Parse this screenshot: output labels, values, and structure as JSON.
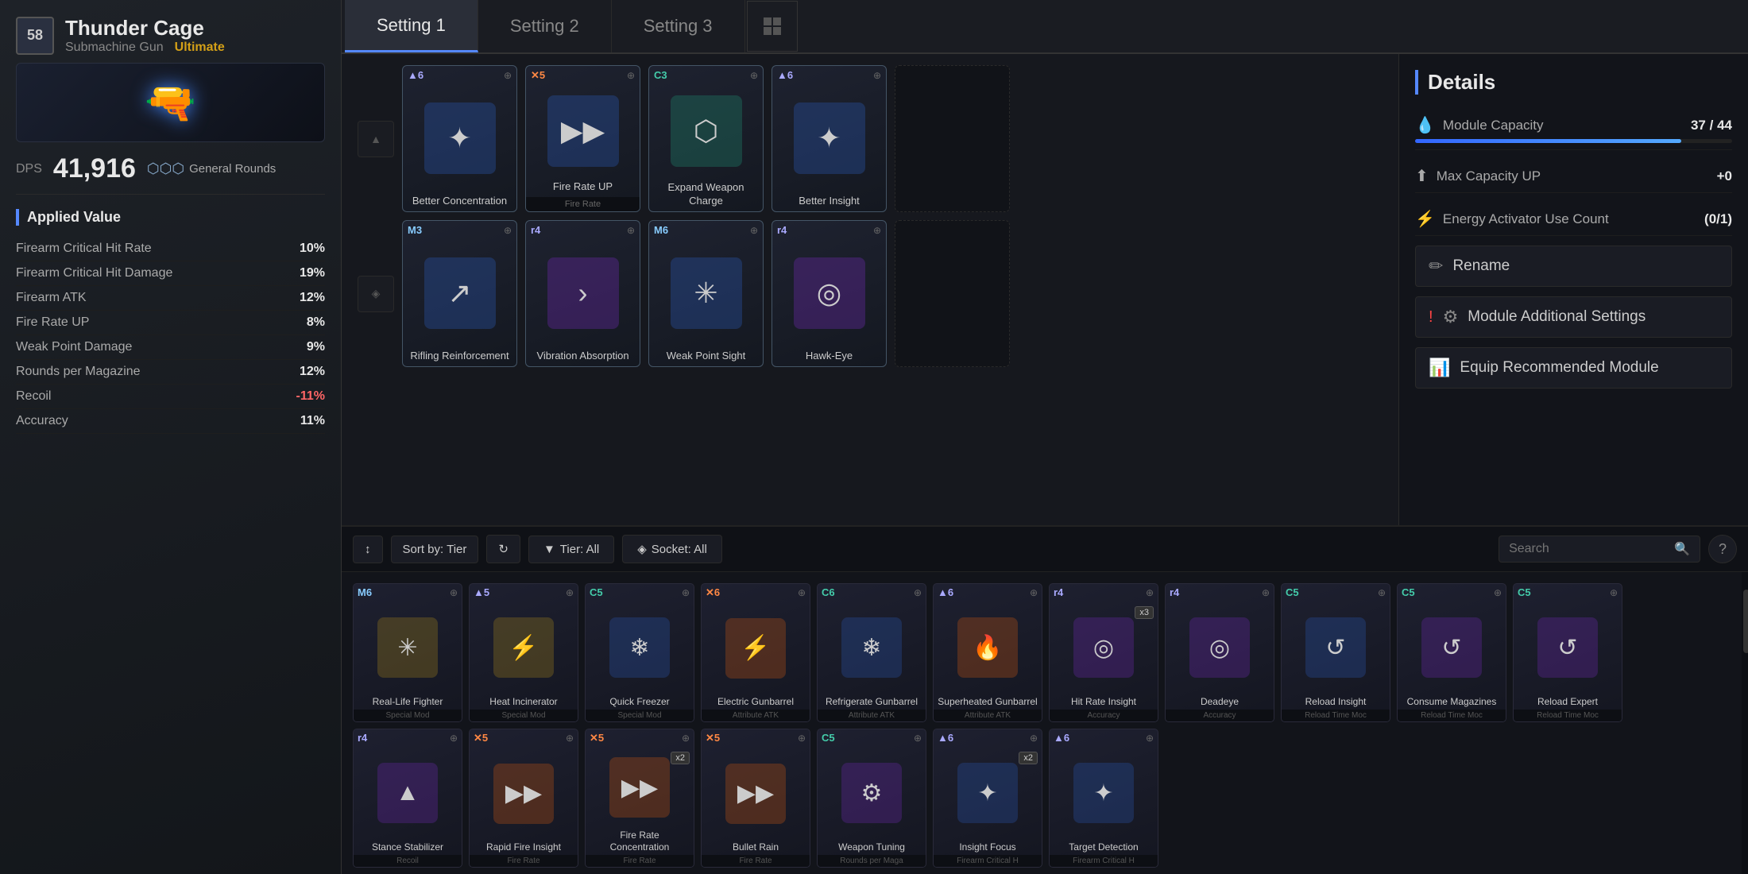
{
  "weapon": {
    "level": "58",
    "name": "Thunder Cage",
    "type": "Submachine Gun",
    "rarity": "Ultimate",
    "dps_label": "DPS",
    "dps_value": "41,916",
    "ammo_type": "General Rounds"
  },
  "applied_value_title": "Applied Value",
  "stats": [
    {
      "name": "Firearm Critical Hit Rate",
      "value": "10%",
      "negative": false
    },
    {
      "name": "Firearm Critical Hit Damage",
      "value": "19%",
      "negative": false
    },
    {
      "name": "Firearm ATK",
      "value": "12%",
      "negative": false
    },
    {
      "name": "Fire Rate UP",
      "value": "8%",
      "negative": false
    },
    {
      "name": "Weak Point Damage",
      "value": "9%",
      "negative": false
    },
    {
      "name": "Rounds per Magazine",
      "value": "12%",
      "negative": false
    },
    {
      "name": "Recoil",
      "value": "-11%",
      "negative": true
    },
    {
      "name": "Accuracy",
      "value": "11%",
      "negative": false
    }
  ],
  "tabs": [
    {
      "label": "Setting 1",
      "active": true
    },
    {
      "label": "Setting 2",
      "active": false
    },
    {
      "label": "Setting 3",
      "active": false
    }
  ],
  "equipped_slots": [
    {
      "row": 1,
      "indicator_icon": "▲",
      "modules": [
        {
          "tier": "▲6",
          "tier_class": "tier-a",
          "socket": "⊕",
          "icon": "✦",
          "bg": "module-card-icon-bg-blue",
          "name": "Better\nConcentration",
          "subtype": ""
        },
        {
          "tier": "✕5",
          "tier_class": "tier-x",
          "socket": "⊕",
          "icon": "▶▶",
          "bg": "module-card-icon-bg-blue",
          "name": "Fire Rate UP",
          "subtype": "Fire Rate"
        },
        {
          "tier": "C3",
          "tier_class": "tier-c",
          "socket": "⊕",
          "icon": "⬡",
          "bg": "module-card-icon-bg-teal",
          "name": "Expand Weapon\nCharge",
          "subtype": ""
        },
        {
          "tier": "▲6",
          "tier_class": "tier-a",
          "socket": "⊕",
          "icon": "✦",
          "bg": "module-card-icon-bg-blue",
          "name": "Better Insight",
          "subtype": ""
        }
      ]
    },
    {
      "row": 2,
      "indicator_icon": "◈",
      "modules": [
        {
          "tier": "M3",
          "tier_class": "tier-m",
          "socket": "⊕",
          "icon": "↗",
          "bg": "module-card-icon-bg-blue",
          "name": "Rifling\nReinforcement",
          "subtype": ""
        },
        {
          "tier": "r4",
          "tier_class": "tier-r",
          "socket": "⊕",
          "icon": "›",
          "bg": "module-card-icon-bg-purple",
          "name": "Vibration\nAbsorption",
          "subtype": ""
        },
        {
          "tier": "M6",
          "tier_class": "tier-m",
          "socket": "⊕",
          "icon": "✳",
          "bg": "module-card-icon-bg-blue",
          "name": "Weak Point Sight",
          "subtype": ""
        },
        {
          "tier": "r4",
          "tier_class": "tier-r",
          "socket": "⊕",
          "icon": "◎",
          "bg": "module-card-icon-bg-purple",
          "name": "Hawk-Eye",
          "subtype": ""
        }
      ]
    }
  ],
  "details": {
    "title": "Details",
    "module_capacity_label": "Module Capacity",
    "module_capacity_current": "37",
    "module_capacity_max": "44",
    "module_capacity_progress": 84,
    "max_capacity_label": "Max Capacity UP",
    "max_capacity_value": "+0",
    "energy_activator_label": "Energy Activator Use Count",
    "energy_activator_value": "(0/1)",
    "rename_label": "Rename",
    "additional_settings_label": "Module Additional Settings",
    "equip_recommended_label": "Equip Recommended Module"
  },
  "inventory": {
    "sort_label": "Sort by: Tier",
    "refresh_icon": "↻",
    "tier_filter_label": "Tier: All",
    "socket_filter_label": "Socket: All",
    "search_placeholder": "Search",
    "help_icon": "?",
    "modules_row1": [
      {
        "tier": "M6",
        "tier_class": "tier-m",
        "socket": "⊕",
        "icon": "✳",
        "bg": "bg-gold",
        "name": "Real-Life Fighter",
        "subtype": "Special Mod",
        "count": null
      },
      {
        "tier": "▲5",
        "tier_class": "tier-a",
        "socket": "⊕",
        "icon": "⚡",
        "bg": "bg-gold",
        "name": "Heat Incinerator",
        "subtype": "Special Mod",
        "count": null
      },
      {
        "tier": "C5",
        "tier_class": "tier-c",
        "socket": "⊕",
        "icon": "❄",
        "bg": "bg-blue",
        "name": "Quick Freezer",
        "subtype": "Special Mod",
        "count": null
      },
      {
        "tier": "✕6",
        "tier_class": "tier-x",
        "socket": "⊕",
        "icon": "⚡",
        "bg": "bg-orange",
        "name": "Electric Gunbarrel",
        "subtype": "Attribute ATK",
        "count": null
      },
      {
        "tier": "C6",
        "tier_class": "tier-c",
        "socket": "⊕",
        "icon": "❄",
        "bg": "bg-blue",
        "name": "Refrigerate Gunbarrel",
        "subtype": "Attribute ATK",
        "count": null
      },
      {
        "tier": "▲6",
        "tier_class": "tier-a",
        "socket": "⊕",
        "icon": "🔥",
        "bg": "bg-orange",
        "name": "Superheated Gunbarrel",
        "subtype": "Attribute ATK",
        "count": null
      },
      {
        "tier": "r4",
        "tier_class": "tier-r",
        "socket": "⊕",
        "icon": "◎",
        "bg": "bg-purple",
        "name": "Hit Rate Insight",
        "subtype": "Accuracy",
        "count": "x3"
      },
      {
        "tier": "r4",
        "tier_class": "tier-r",
        "socket": "⊕",
        "icon": "◎",
        "bg": "bg-purple",
        "name": "Deadeye",
        "subtype": "Accuracy",
        "count": null
      },
      {
        "tier": "C5",
        "tier_class": "tier-c",
        "socket": "⊕",
        "icon": "↺",
        "bg": "bg-blue",
        "name": "Reload Insight",
        "subtype": "Reload Time Moc",
        "count": null
      }
    ],
    "modules_row2": [
      {
        "tier": "C5",
        "tier_class": "tier-c",
        "socket": "⊕",
        "icon": "↺",
        "bg": "bg-purple",
        "name": "Consume Magazines",
        "subtype": "Reload Time Moc",
        "count": null
      },
      {
        "tier": "C5",
        "tier_class": "tier-c",
        "socket": "⊕",
        "icon": "↺",
        "bg": "bg-purple",
        "name": "Reload Expert",
        "subtype": "Reload Time Moc",
        "count": null
      },
      {
        "tier": "r4",
        "tier_class": "tier-r",
        "socket": "⊕",
        "icon": "▲",
        "bg": "bg-purple",
        "name": "Stance Stabilizer",
        "subtype": "Recoil",
        "count": null
      },
      {
        "tier": "✕5",
        "tier_class": "tier-x",
        "socket": "⊕",
        "icon": "▶▶",
        "bg": "bg-orange",
        "name": "Rapid Fire Insight",
        "subtype": "Fire Rate",
        "count": null
      },
      {
        "tier": "✕5",
        "tier_class": "tier-x",
        "socket": "⊕",
        "icon": "▶▶",
        "bg": "bg-orange",
        "name": "Fire Rate Concentration",
        "subtype": "Fire Rate",
        "count": "x2"
      },
      {
        "tier": "✕5",
        "tier_class": "tier-x",
        "socket": "⊕",
        "icon": "▶▶",
        "bg": "bg-orange",
        "name": "Bullet Rain",
        "subtype": "Fire Rate",
        "count": null
      },
      {
        "tier": "C5",
        "tier_class": "tier-c",
        "socket": "⊕",
        "icon": "⚙",
        "bg": "bg-purple",
        "name": "Weapon Tuning",
        "subtype": "Rounds per Maga",
        "count": null
      },
      {
        "tier": "▲6",
        "tier_class": "tier-a",
        "socket": "⊕",
        "icon": "✦",
        "bg": "bg-blue",
        "name": "Insight Focus",
        "subtype": "Firearm Critical H",
        "count": "x2"
      },
      {
        "tier": "▲6",
        "tier_class": "tier-a",
        "socket": "⊕",
        "icon": "✦",
        "bg": "bg-blue",
        "name": "Target Detection",
        "subtype": "Firearm Critical H",
        "count": null
      }
    ]
  }
}
